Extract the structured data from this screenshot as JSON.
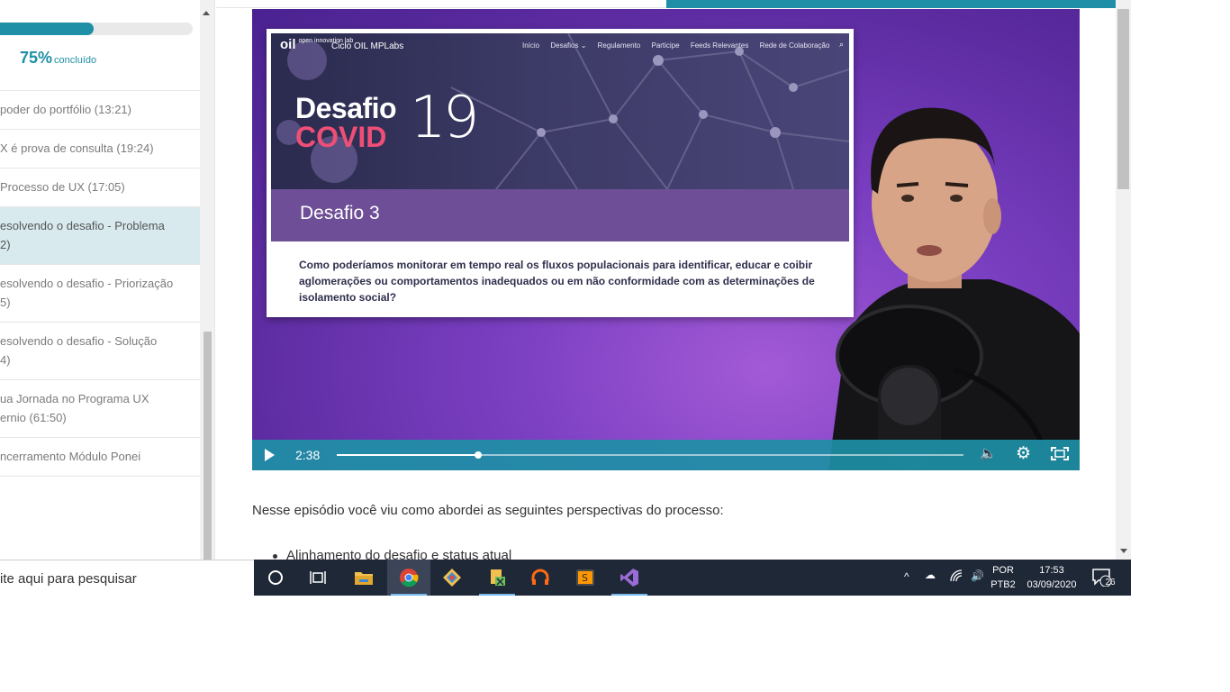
{
  "sidebar": {
    "progress_percent": "75%",
    "progress_value": 0.75,
    "progress_label": "concluído",
    "items": [
      {
        "line1": "poder do portfólio (13:21)",
        "line2": ""
      },
      {
        "line1": "X é prova de consulta (19:24)",
        "line2": ""
      },
      {
        "line1": "Processo de UX (17:05)",
        "line2": ""
      },
      {
        "line1": "esolvendo o desafio - Problema",
        "line2": "2)"
      },
      {
        "line1": "esolvendo o desafio - Priorização",
        "line2": "5)"
      },
      {
        "line1": "esolvendo o desafio - Solução",
        "line2": "4)"
      },
      {
        "line1": "ua Jornada no Programa UX",
        "line2": "ernio (61:50)"
      },
      {
        "line1": "ncerramento Módulo Ponei",
        "line2": ""
      }
    ]
  },
  "video": {
    "slide": {
      "logo": "open innovation lab",
      "logo_mark": "oil",
      "site": "Ciclo OIL MPLabs",
      "nav": [
        "Início",
        "Desafios ⌄",
        "Regulamento",
        "Participe",
        "Feeds Relevantes",
        "Rede de Colaboração"
      ],
      "title_line1": "Desafio",
      "title_line2": "COVID",
      "title_number": "19",
      "band_title": "Desafio 3",
      "question": "Como poderíamos monitorar em tempo real os fluxos populacionais para identificar, educar e coibir aglomerações ou comportamentos inadequados ou em não conformidade com as determinações de isolamento social?"
    },
    "time": "2:38",
    "progress_fraction": 0.225
  },
  "article": {
    "paragraph": "Nesse episódio você viu como abordei as seguintes perspectivas do processo:",
    "bullet_1": "Alinhamento do desafio e status atual"
  },
  "taskbar": {
    "search_text": "ite aqui para pesquisar",
    "lang_1": "POR",
    "lang_2": "PTB2",
    "time": "17:53",
    "date": "03/09/2020",
    "notification_count": "26"
  },
  "colors": {
    "accent": "#1e8fa6",
    "video_bg": "#7b3fc2",
    "covid_pink": "#ef4f76",
    "taskbar": "#1f2837"
  }
}
